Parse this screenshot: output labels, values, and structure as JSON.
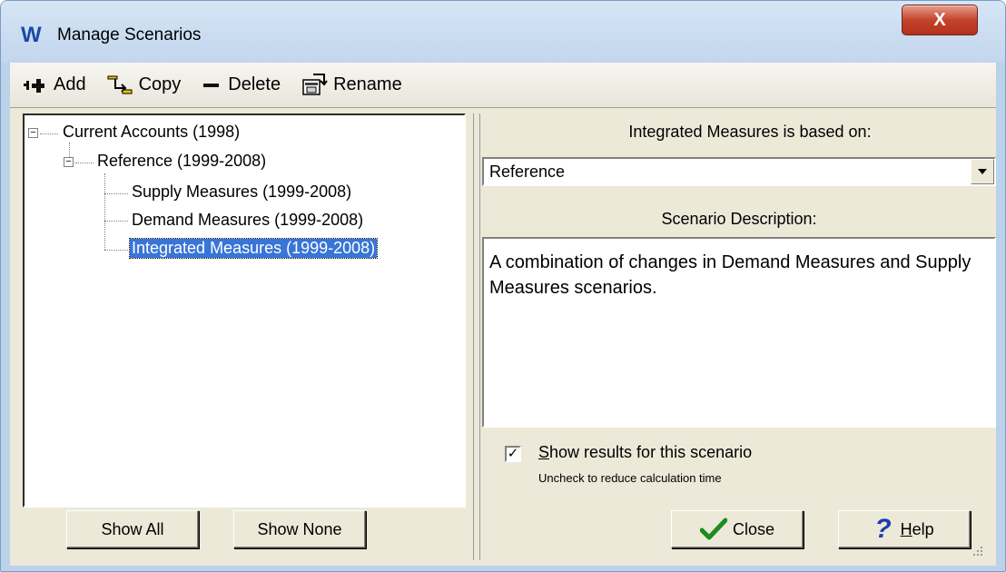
{
  "window": {
    "logo": "W",
    "title": "Manage Scenarios",
    "close_label": "X"
  },
  "toolbar": {
    "add_label": "Add",
    "copy_label": "Copy",
    "delete_label": "Delete",
    "rename_label": "Rename"
  },
  "tree": {
    "root": "Current Accounts (1998)",
    "child": "Reference (1999-2008)",
    "items": [
      "Supply Measures (1999-2008)",
      "Demand Measures (1999-2008)",
      "Integrated Measures (1999-2008)"
    ],
    "selected_index": 2
  },
  "right": {
    "based_on_label": "Integrated Measures is based on:",
    "based_on_value": "Reference",
    "description_label": "Scenario Description:",
    "description_text": "A combination of changes in Demand Measures and Supply Measures scenarios.",
    "show_results_label": "Show results for this scenario",
    "show_results_checked": true,
    "hint": "Uncheck to reduce calculation time"
  },
  "buttons": {
    "show_all": "Show All",
    "show_none": "Show None",
    "close": "Close",
    "help_prefix": "H",
    "help_rest": "elp"
  }
}
